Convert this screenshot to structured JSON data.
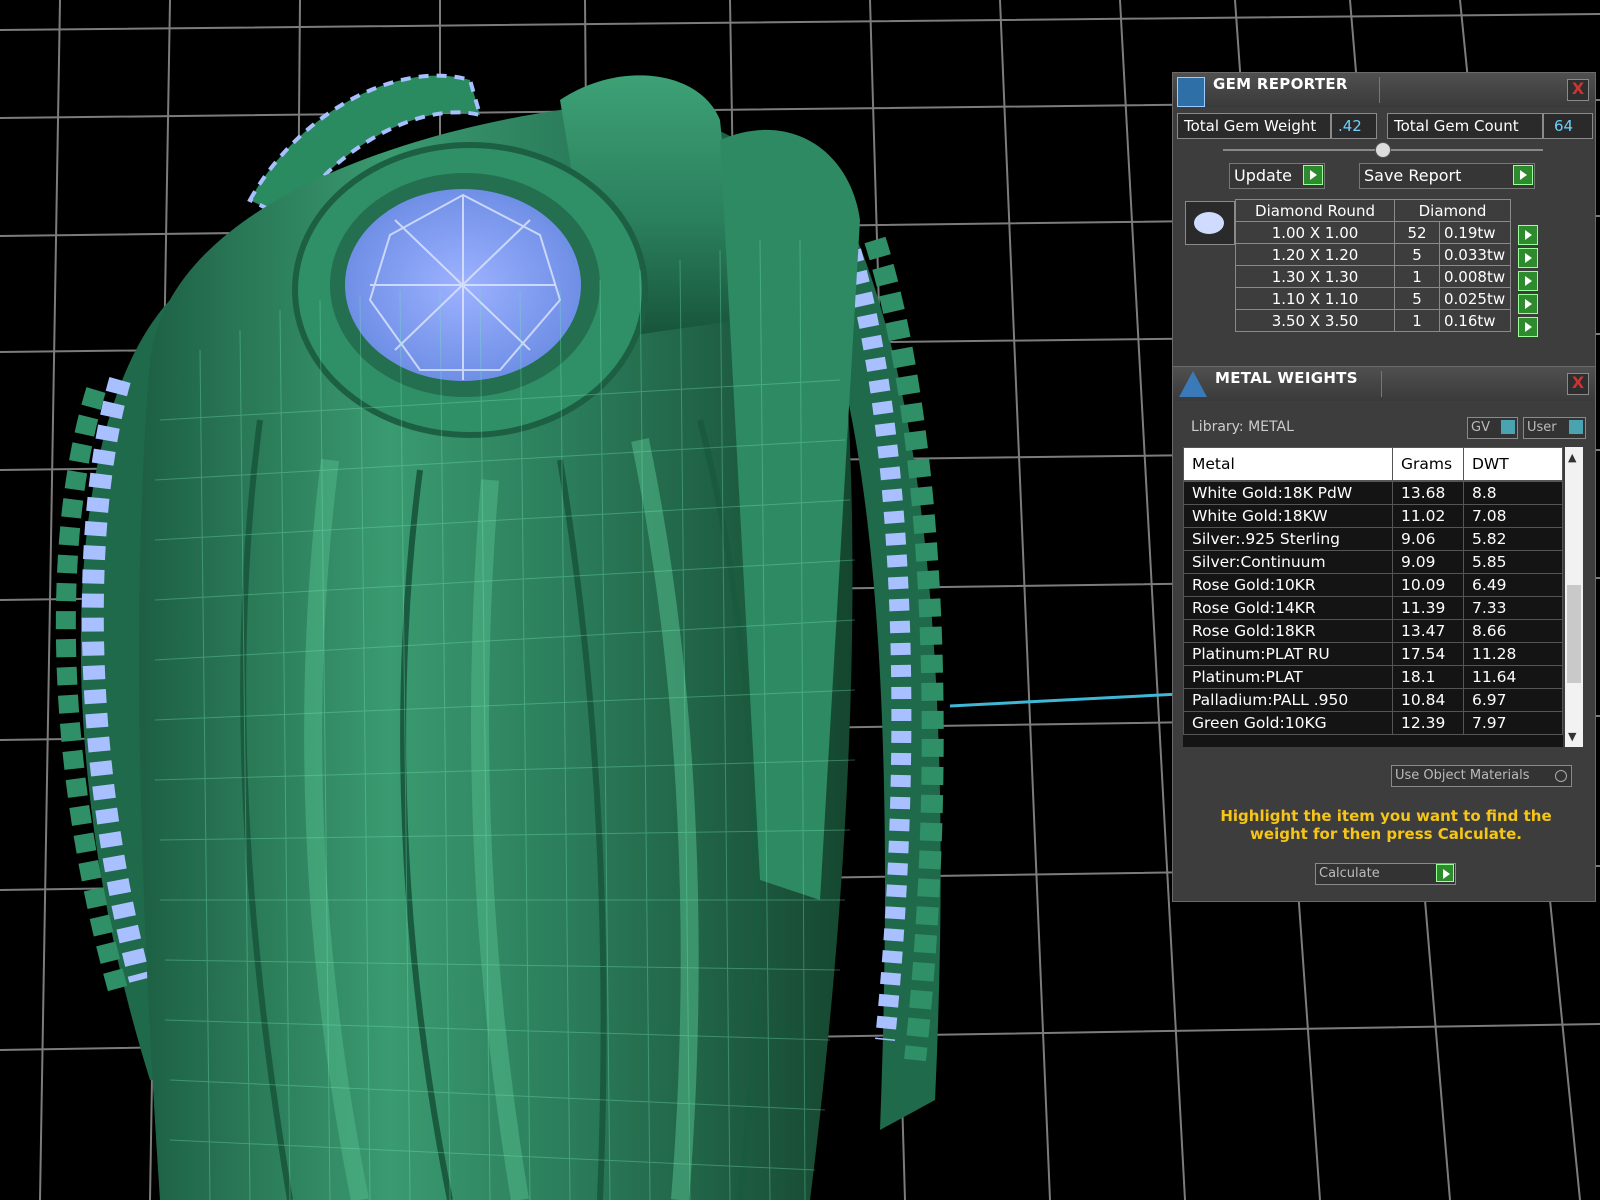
{
  "gem_reporter": {
    "title": "GEM REPORTER",
    "close": "X",
    "total_weight_label": "Total Gem Weight",
    "total_weight_value": ".42",
    "total_count_label": "Total Gem Count",
    "total_count_value": "64",
    "update_label": "Update",
    "save_report_label": "Save Report",
    "table": {
      "headers": [
        "Diamond Round",
        "Diamond"
      ],
      "rows": [
        {
          "size": "1.00 X 1.00",
          "count": "52",
          "weight": "0.19tw"
        },
        {
          "size": "1.20 X 1.20",
          "count": "5",
          "weight": "0.033tw"
        },
        {
          "size": "1.30 X 1.30",
          "count": "1",
          "weight": "0.008tw"
        },
        {
          "size": "1.10 X 1.10",
          "count": "5",
          "weight": "0.025tw"
        },
        {
          "size": "3.50 X 3.50",
          "count": "1",
          "weight": "0.16tw"
        }
      ]
    }
  },
  "metal_weights": {
    "title": "METAL WEIGHTS",
    "close": "X",
    "library_label": "Library: METAL",
    "gv_label": "GV",
    "user_label": "User",
    "columns": [
      "Metal",
      "Grams",
      "DWT"
    ],
    "rows": [
      {
        "metal": "White Gold:18K PdW",
        "grams": "13.68",
        "dwt": "8.8"
      },
      {
        "metal": "White Gold:18KW",
        "grams": "11.02",
        "dwt": "7.08"
      },
      {
        "metal": "Silver:.925 Sterling",
        "grams": "9.06",
        "dwt": "5.82"
      },
      {
        "metal": "Silver:Continuum",
        "grams": "9.09",
        "dwt": "5.85"
      },
      {
        "metal": "Rose Gold:10KR",
        "grams": "10.09",
        "dwt": "6.49"
      },
      {
        "metal": "Rose Gold:14KR",
        "grams": "11.39",
        "dwt": "7.33"
      },
      {
        "metal": "Rose Gold:18KR",
        "grams": "13.47",
        "dwt": "8.66"
      },
      {
        "metal": "Platinum:PLAT RU",
        "grams": "17.54",
        "dwt": "11.28"
      },
      {
        "metal": "Platinum:PLAT",
        "grams": "18.1",
        "dwt": "11.64"
      },
      {
        "metal": "Palladium:PALL .950",
        "grams": "10.84",
        "dwt": "6.97"
      },
      {
        "metal": "Green Gold:10KG",
        "grams": "12.39",
        "dwt": "7.97"
      }
    ],
    "use_object_materials_label": "Use Object Materials",
    "hint": "Highlight the item you want to find the weight for then press Calculate.",
    "calculate_label": "Calculate"
  },
  "colors": {
    "ring_green": "#2e8c66",
    "wire": "#6fe0b4",
    "gem_blue": "#9fb6ff",
    "hint_yellow": "#f5c518"
  }
}
